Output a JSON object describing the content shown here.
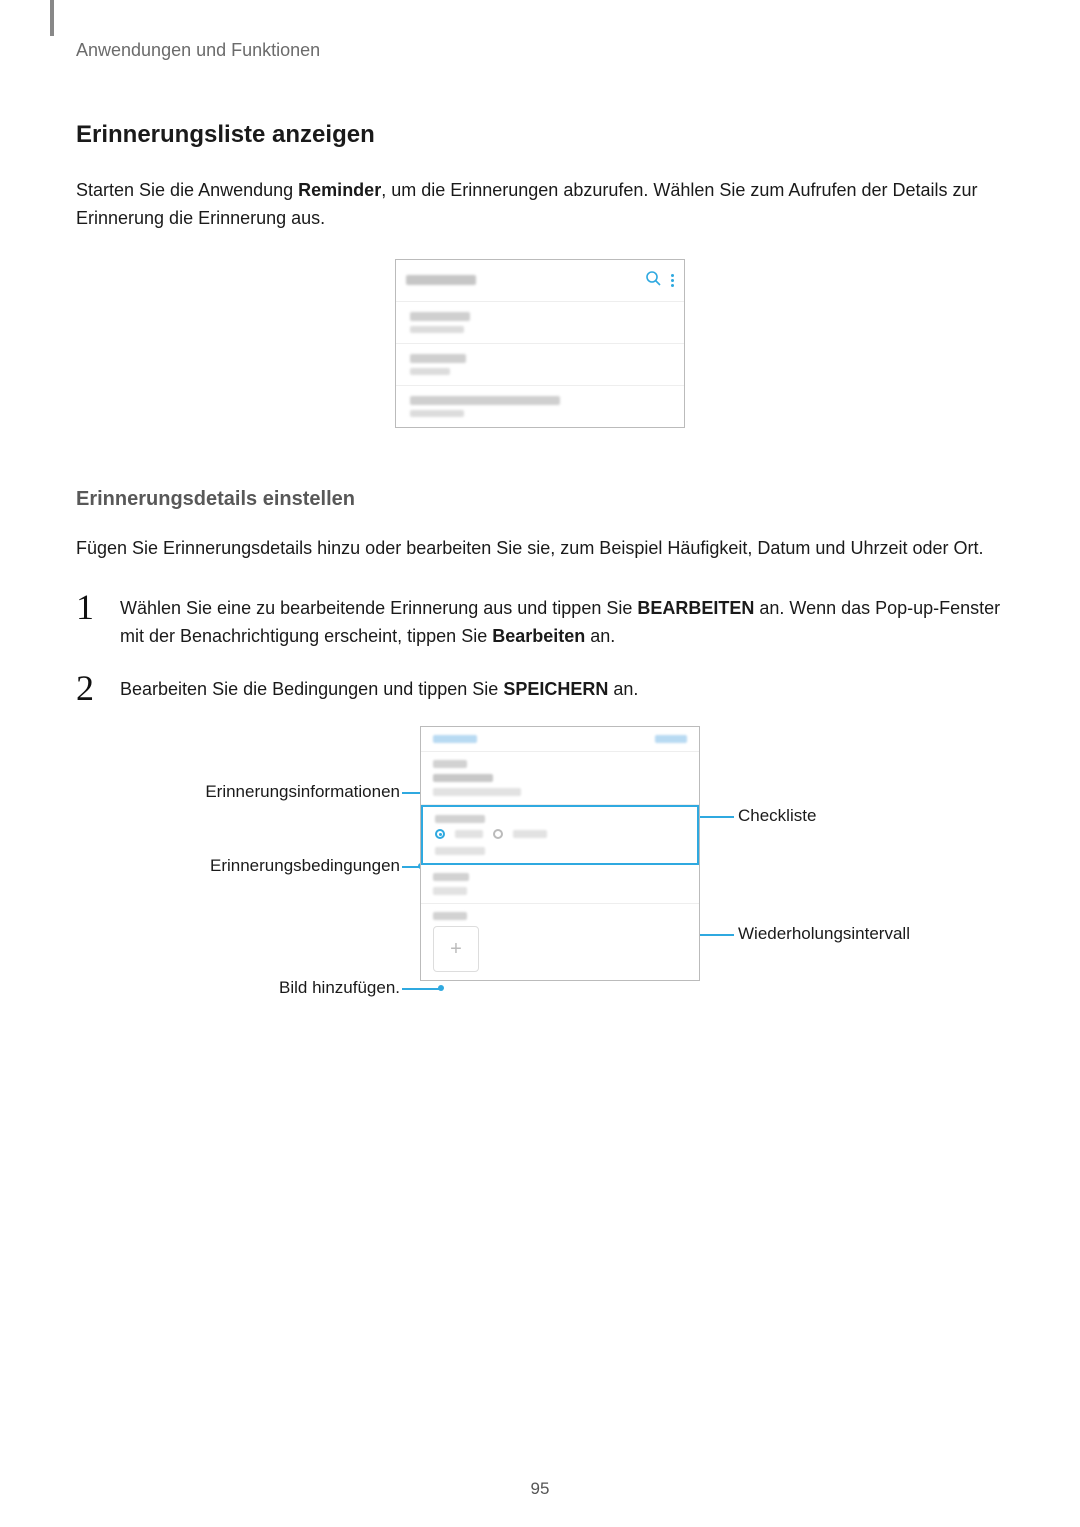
{
  "breadcrumb": "Anwendungen und Funktionen",
  "section_title": "Erinnerungsliste anzeigen",
  "intro": {
    "p1a": "Starten Sie die Anwendung ",
    "p1_strong": "Reminder",
    "p1b": ", um die Erinnerungen abzurufen. Wählen Sie zum Aufrufen der Details zur Erinnerung die Erinnerung aus."
  },
  "sub_title": "Erinnerungsdetails einstellen",
  "sub_para": "Fügen Sie Erinnerungsdetails hinzu oder bearbeiten Sie sie, zum Beispiel Häufigkeit, Datum und Uhrzeit oder Ort.",
  "steps": {
    "s1": {
      "num": "1",
      "a": "Wählen Sie eine zu bearbeitende Erinnerung aus und tippen Sie ",
      "strong1": "BEARBEITEN",
      "b": " an. Wenn das Pop-up-Fenster mit der Benachrichtigung erscheint, tippen Sie ",
      "strong2": "Bearbeiten",
      "c": " an."
    },
    "s2": {
      "num": "2",
      "a": "Bearbeiten Sie die Bedingungen und tippen Sie ",
      "strong1": "SPEICHERN",
      "b": " an."
    }
  },
  "callouts": {
    "left1": "Erinnerungsinformationen",
    "left2": "Erinnerungsbedingungen",
    "left3": "Bild hinzufügen.",
    "right1": "Checkliste",
    "right2": "Wiederholungsintervall"
  },
  "edit_screen": {
    "add_icon": "+"
  },
  "page_number": "95"
}
